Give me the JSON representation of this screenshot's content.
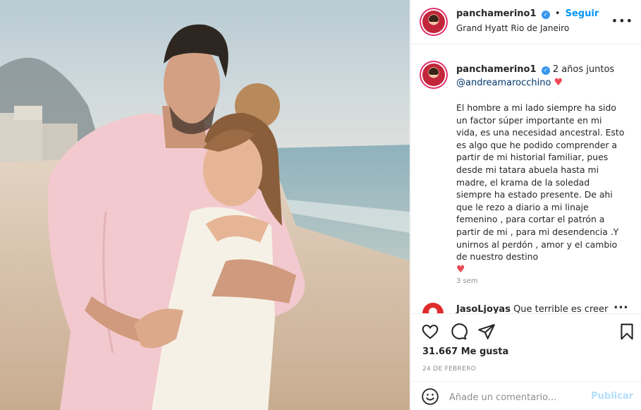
{
  "post": {
    "username": "panchamerino1",
    "verified_mark": "✓",
    "separator": "•",
    "follow_label": "Seguir",
    "location": "Grand Hyatt Rio de Janeiro",
    "more_icon": "more-options-icon",
    "more_glyph": "•••"
  },
  "caption": {
    "username": "panchamerino1",
    "title": "2 años juntos",
    "mention": "@andreamarocchino",
    "heart": "♥",
    "body": "El hombre a mi lado siempre ha sido un factor súper importante en mi vida, es una necesidad ancestral. Esto es algo que he podido comprender a partir de mi historial familiar, pues desde mi tatara abuela hasta mi madre, el krama de la soledad siempre ha estado presente. De ahi que le rezo a diario a mi linaje femenino , para cortar el patrón a partir de mi , para mi desendencia .Y unirnos al perdón , amor y el cambio de nuestro destino",
    "end_heart": "♥",
    "time_ago": "3 sem"
  },
  "comment": {
    "username": "JasoLjoyas",
    "text": "Que terrible es creer",
    "more_glyph": "•••"
  },
  "actions": {
    "likes": "31.667 Me gusta",
    "date": "24 DE FEBRERO"
  },
  "add_comment": {
    "placeholder": "Añade un comentario...",
    "publish_label": "Publicar"
  },
  "colors": {
    "accent": "#0095f6",
    "heart": "#ed4956",
    "publish_disabled": "#b2dffc"
  }
}
